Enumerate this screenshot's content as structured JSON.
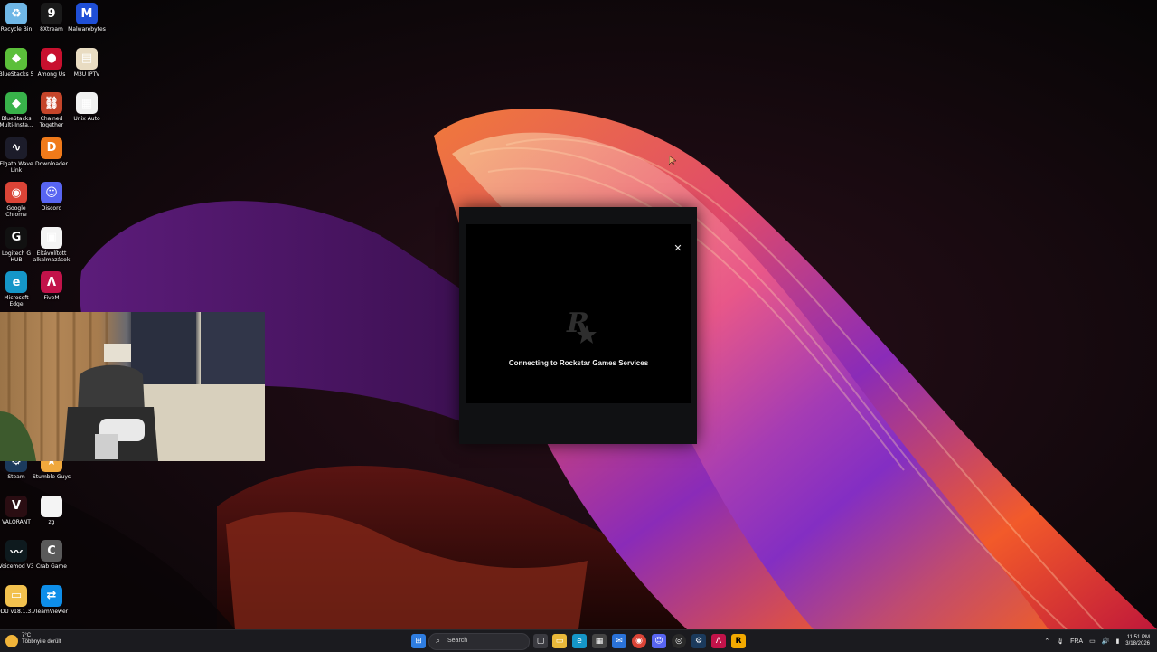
{
  "desktop": {
    "icons": [
      {
        "label": "Recycle Bin",
        "icon": "recycle-bin-icon",
        "color": "#6fb7e6",
        "glyph": "♻"
      },
      {
        "label": "8Xtream",
        "icon": "8xtream-icon",
        "color": "#1a1a1a",
        "glyph": "9"
      },
      {
        "label": "Malwarebytes",
        "icon": "malwarebytes-icon",
        "color": "#1f4fd6",
        "glyph": "M"
      },
      {
        "label": "BlueStacks 5",
        "icon": "bluestacks-icon",
        "color": "#5bbf3a",
        "glyph": "◆"
      },
      {
        "label": "Among Us",
        "icon": "among-us-icon",
        "color": "#c8102e",
        "glyph": "●"
      },
      {
        "label": "M3U IPTV",
        "icon": "m3u-iptv-icon",
        "color": "#e9dcc2",
        "glyph": "▤"
      },
      {
        "label": "BlueStacks Multi-Insta...",
        "icon": "bluestacks-multi-icon",
        "color": "#38b24a",
        "glyph": "◆"
      },
      {
        "label": "Chained Together",
        "icon": "chained-together-icon",
        "color": "#c5452a",
        "glyph": "⛓"
      },
      {
        "label": "Unix Auto",
        "icon": "unix-auto-icon",
        "color": "#f1f1f1",
        "glyph": "▦"
      },
      {
        "label": "Elgato Wave Link",
        "icon": "elgato-wave-link-icon",
        "color": "#1c1c2a",
        "glyph": "∿"
      },
      {
        "label": "Downloader",
        "icon": "downloader-icon",
        "color": "#f07a1a",
        "glyph": "D"
      },
      {
        "label": "Google Chrome",
        "icon": "chrome-icon",
        "color": "#db4437",
        "glyph": "◉"
      },
      {
        "label": "Discord",
        "icon": "discord-icon",
        "color": "#5865f2",
        "glyph": "☺"
      },
      {
        "label": "Logitech G HUB",
        "icon": "logitech-ghub-icon",
        "color": "#111",
        "glyph": "G"
      },
      {
        "label": "Eltávolított alkalmazások",
        "icon": "removed-apps-icon",
        "color": "#f4f4f4",
        "glyph": "▣"
      },
      {
        "label": "Microsoft Edge",
        "icon": "edge-icon",
        "color": "#1596c8",
        "glyph": "e"
      },
      {
        "label": "FiveM",
        "icon": "fivem-icon",
        "color": "#c2134a",
        "glyph": "Λ"
      },
      {
        "label": "Steam",
        "icon": "steam-icon",
        "color": "#1b3a5c",
        "glyph": "⚙"
      },
      {
        "label": "Stumble Guys",
        "icon": "stumble-guys-icon",
        "color": "#f0a83c",
        "glyph": "★"
      },
      {
        "label": "VALORANT",
        "icon": "valorant-icon",
        "color": "#2a0d12",
        "glyph": "V"
      },
      {
        "label": "zg",
        "icon": "file-icon",
        "color": "#f4f4f4",
        "glyph": ""
      },
      {
        "label": "Voicemod V3",
        "icon": "voicemod-icon",
        "color": "#0e1a1e",
        "glyph": "〰"
      },
      {
        "label": "Crab Game",
        "icon": "crab-game-icon",
        "color": "#5a5a5a",
        "glyph": "C"
      },
      {
        "label": "DDU v18.1.3.7",
        "icon": "folder-icon",
        "color": "#f2c14e",
        "glyph": "▭"
      },
      {
        "label": "TeamViewer",
        "icon": "teamviewer-icon",
        "color": "#0e8ee9",
        "glyph": "⇄"
      }
    ]
  },
  "launcher": {
    "status": "Connecting to Rockstar Games Services",
    "logo": "rockstar-logo",
    "close_glyph": "✕"
  },
  "taskbar": {
    "weather": {
      "temp": "7°C",
      "desc": "Többnyire derült"
    },
    "search_placeholder": "Search",
    "language": "FRA",
    "time": "11:51 PM",
    "date": "3/18/2026",
    "apps": [
      "start-icon",
      "task-view-icon",
      "file-explorer-icon",
      "edge-icon",
      "microsoft-store-icon",
      "mail-icon",
      "chrome-icon",
      "discord-icon",
      "obs-icon",
      "steam-icon",
      "fivem-icon",
      "rockstar-launcher-icon"
    ]
  }
}
